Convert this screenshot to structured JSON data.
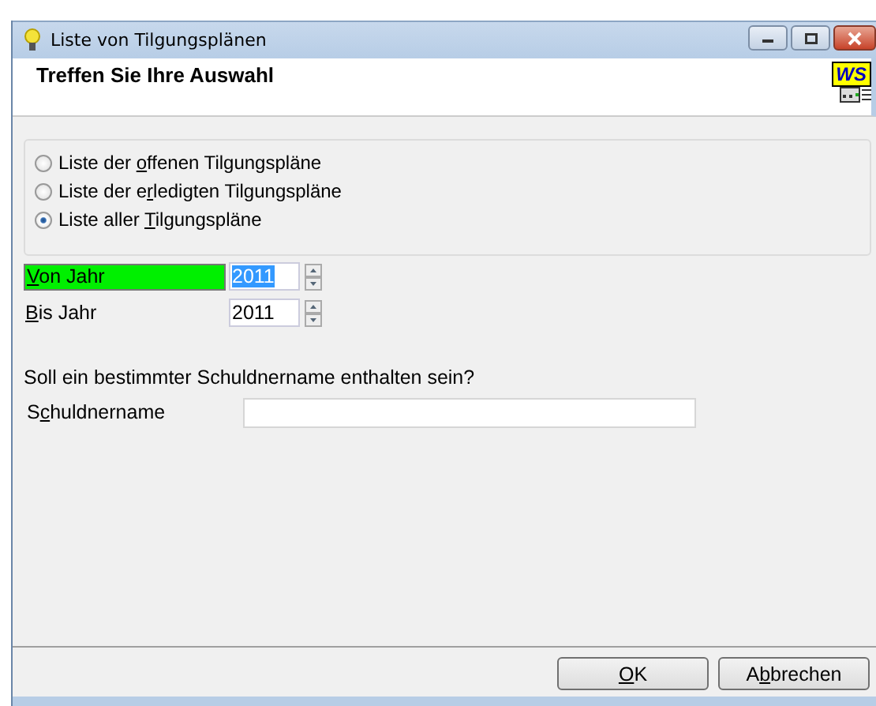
{
  "window": {
    "title": "Liste von Tilgungsplänen"
  },
  "header": {
    "title": "Treffen Sie Ihre Auswahl",
    "logo": "WS"
  },
  "options": [
    {
      "pre": "Liste der ",
      "key": "o",
      "post": "ffenen Tilgungspläne",
      "selected": false
    },
    {
      "pre": "Liste der e",
      "key": "r",
      "post": "ledigten Tilgungspläne",
      "selected": false
    },
    {
      "pre": "Liste aller ",
      "key": "T",
      "post": "ilgungspläne",
      "selected": true
    }
  ],
  "years": [
    {
      "key": "V",
      "post": "on Jahr",
      "value": "2011",
      "focused": true
    },
    {
      "key": "B",
      "post": "is Jahr",
      "value": "2011",
      "focused": false
    }
  ],
  "question": "Soll ein bestimmter Schuldnername enthalten sein?",
  "name_field": {
    "pre": "S",
    "key": "c",
    "post": "huldnername"
  },
  "buttons": [
    {
      "key": "O",
      "post": "K"
    },
    {
      "pre": "A",
      "key": "b",
      "post": "brechen"
    }
  ]
}
